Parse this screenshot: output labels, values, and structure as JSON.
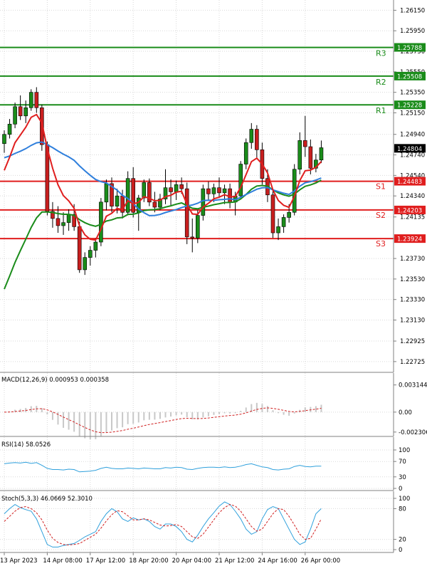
{
  "colors": {
    "background": "#ffffff",
    "grid": "#d9d9d9",
    "frame": "#b0b0b0",
    "bull_candle": "#1a8c1a",
    "bear_candle": "#c81e1e",
    "resistance": "#1a8c1a",
    "support": "#e01e1e",
    "ma_red": "#e01e1e",
    "ma_blue": "#2f7fdc",
    "ma_green": "#1a8c1a",
    "macd_hist": "#c8c8c8",
    "macd_signal": "#d02020",
    "rsi_line": "#2fa0dc",
    "stoch_k": "#2fa0dc",
    "stoch_d": "#d02020",
    "price_tag": "#000000"
  },
  "chart_data": [
    {
      "type": "candlestick",
      "title": "",
      "ylim": [
        1.2262,
        1.2625
      ],
      "y_ticks": [
        "1.26150",
        "1.25950",
        "1.25750",
        "1.25550",
        "1.25350",
        "1.25150",
        "1.24940",
        "1.24740",
        "1.24540",
        "1.24340",
        "1.24135",
        "1.23924",
        "1.23730",
        "1.23530",
        "1.23330",
        "1.23130",
        "1.22925",
        "1.22725"
      ],
      "x_tick_labels": [
        "13 Apr 2023",
        "14 Apr 08:00",
        "17 Apr 12:00",
        "18 Apr 20:00",
        "20 Apr 04:00",
        "21 Apr 12:00",
        "24 Apr 16:00",
        "26 Apr 00:00"
      ],
      "levels": [
        {
          "label": "R3",
          "value": 1.25788,
          "tag": "1.25788",
          "kind": "resistance"
        },
        {
          "label": "R2",
          "value": 1.25508,
          "tag": "1.25508",
          "kind": "resistance"
        },
        {
          "label": "R1",
          "value": 1.25228,
          "tag": "1.25228",
          "kind": "resistance"
        },
        {
          "label": "S1",
          "value": 1.24483,
          "tag": "1.24483",
          "kind": "support"
        },
        {
          "label": "S2",
          "value": 1.24203,
          "tag": "1.24203",
          "kind": "support"
        },
        {
          "label": "S3",
          "value": 1.23924,
          "tag": "1.23924",
          "kind": "support"
        }
      ],
      "current_price": {
        "value": 1.24804,
        "tag": "1.24804"
      },
      "candles": [
        [
          1.2485,
          1.2498,
          1.2476,
          1.2494
        ],
        [
          1.2494,
          1.2509,
          1.249,
          1.2504
        ],
        [
          1.2504,
          1.2525,
          1.25,
          1.2521
        ],
        [
          1.2521,
          1.2532,
          1.2508,
          1.2512
        ],
        [
          1.2512,
          1.2527,
          1.2505,
          1.252
        ],
        [
          1.252,
          1.2538,
          1.2517,
          1.2535
        ],
        [
          1.2535,
          1.254,
          1.2515,
          1.252
        ],
        [
          1.252,
          1.2523,
          1.2478,
          1.2484
        ],
        [
          1.2484,
          1.2487,
          1.2415,
          1.2419
        ],
        [
          1.2419,
          1.2428,
          1.2403,
          1.2412
        ],
        [
          1.2412,
          1.2424,
          1.2398,
          1.2405
        ],
        [
          1.2405,
          1.2418,
          1.2396,
          1.2408
        ],
        [
          1.2408,
          1.2421,
          1.24,
          1.2416
        ],
        [
          1.2416,
          1.2426,
          1.24,
          1.2404
        ],
        [
          1.2404,
          1.2409,
          1.2359,
          1.2362
        ],
        [
          1.2362,
          1.2379,
          1.2357,
          1.2374
        ],
        [
          1.2374,
          1.2385,
          1.2366,
          1.2381
        ],
        [
          1.2381,
          1.2393,
          1.2374,
          1.2389
        ],
        [
          1.2389,
          1.2432,
          1.2385,
          1.2428
        ],
        [
          1.2428,
          1.245,
          1.242,
          1.2446
        ],
        [
          1.2446,
          1.2452,
          1.2418,
          1.2424
        ],
        [
          1.2424,
          1.2441,
          1.2417,
          1.2434
        ],
        [
          1.2434,
          1.244,
          1.2412,
          1.2418
        ],
        [
          1.2418,
          1.2458,
          1.2415,
          1.2451
        ],
        [
          1.2451,
          1.2462,
          1.2413,
          1.2418
        ],
        [
          1.2418,
          1.2435,
          1.24,
          1.2432
        ],
        [
          1.2432,
          1.245,
          1.2428,
          1.2447
        ],
        [
          1.2447,
          1.2451,
          1.2424,
          1.2428
        ],
        [
          1.2428,
          1.2438,
          1.2418,
          1.2423
        ],
        [
          1.2423,
          1.2436,
          1.242,
          1.2431
        ],
        [
          1.2431,
          1.246,
          1.2426,
          1.2442
        ],
        [
          1.2442,
          1.245,
          1.2425,
          1.2438
        ],
        [
          1.2438,
          1.2449,
          1.243,
          1.2445
        ],
        [
          1.2445,
          1.2452,
          1.2436,
          1.2441
        ],
        [
          1.2441,
          1.2447,
          1.2387,
          1.2394
        ],
        [
          1.2394,
          1.2412,
          1.2379,
          1.2393
        ],
        [
          1.2393,
          1.242,
          1.2388,
          1.2415
        ],
        [
          1.2415,
          1.2445,
          1.241,
          1.2441
        ],
        [
          1.2441,
          1.2448,
          1.243,
          1.2436
        ],
        [
          1.2436,
          1.2446,
          1.2428,
          1.2442
        ],
        [
          1.2442,
          1.2452,
          1.2432,
          1.2437
        ],
        [
          1.2437,
          1.2445,
          1.2426,
          1.2441
        ],
        [
          1.2441,
          1.2446,
          1.2422,
          1.2428
        ],
        [
          1.2428,
          1.2438,
          1.2415,
          1.2434
        ],
        [
          1.2434,
          1.2468,
          1.2432,
          1.2465
        ],
        [
          1.2465,
          1.249,
          1.246,
          1.2486
        ],
        [
          1.2486,
          1.2505,
          1.248,
          1.2499
        ],
        [
          1.2499,
          1.2503,
          1.247,
          1.2479
        ],
        [
          1.2479,
          1.2486,
          1.2445,
          1.2451
        ],
        [
          1.2451,
          1.246,
          1.2428,
          1.2435
        ],
        [
          1.2435,
          1.2441,
          1.2393,
          1.2398
        ],
        [
          1.2398,
          1.2412,
          1.2391,
          1.2404
        ],
        [
          1.2404,
          1.2416,
          1.2398,
          1.2413
        ],
        [
          1.2413,
          1.2426,
          1.2408,
          1.2418
        ],
        [
          1.2418,
          1.2465,
          1.2415,
          1.246
        ],
        [
          1.246,
          1.2496,
          1.2455,
          1.2488
        ],
        [
          1.2488,
          1.2512,
          1.2472,
          1.2482
        ],
        [
          1.2482,
          1.2489,
          1.2455,
          1.2461
        ],
        [
          1.2461,
          1.2475,
          1.2457,
          1.2469
        ],
        [
          1.2469,
          1.2488,
          1.2466,
          1.2481
        ]
      ]
    },
    {
      "type": "macd",
      "label": "MACD(12,26,9) 0.000953 0.000358",
      "y_ticks": [
        "0.003144",
        "0.00",
        "-0.002306"
      ],
      "ylim": [
        -0.0024,
        0.0032
      ]
    },
    {
      "type": "rsi",
      "label": "RSI(14) 58.0526",
      "y_ticks": [
        "100",
        "70",
        "30",
        "0"
      ],
      "ylim": [
        0,
        100
      ],
      "values": [
        64,
        66,
        67,
        66,
        68,
        65,
        67,
        60,
        52,
        49,
        49,
        48,
        50,
        49,
        43,
        44,
        45,
        47,
        52,
        55,
        52,
        51,
        51,
        53,
        52,
        51,
        53,
        52,
        51,
        51,
        54,
        53,
        55,
        54,
        50,
        49,
        52,
        54,
        55,
        55,
        54,
        56,
        54,
        55,
        58,
        62,
        64,
        60,
        56,
        54,
        49,
        48,
        50,
        51,
        57,
        60,
        57,
        56,
        58,
        58
      ]
    },
    {
      "type": "stochastic",
      "label": "Stoch(5,3,3) 46.0669 52.3010",
      "y_ticks": [
        "100",
        "80",
        "20",
        "0"
      ],
      "ylim": [
        0,
        100
      ],
      "k": [
        70,
        80,
        88,
        82,
        78,
        75,
        60,
        35,
        10,
        5,
        5,
        8,
        10,
        12,
        18,
        25,
        30,
        35,
        55,
        70,
        80,
        74,
        60,
        55,
        62,
        58,
        60,
        55,
        45,
        40,
        50,
        50,
        45,
        35,
        20,
        15,
        28,
        45,
        60,
        72,
        85,
        93,
        88,
        75,
        60,
        40,
        30,
        35,
        60,
        78,
        84,
        80,
        60,
        40,
        20,
        10,
        15,
        40,
        70,
        80
      ],
      "d": [
        55,
        65,
        75,
        82,
        84,
        80,
        72,
        58,
        38,
        22,
        14,
        10,
        9,
        10,
        12,
        18,
        24,
        30,
        42,
        56,
        68,
        76,
        74,
        66,
        58,
        58,
        60,
        58,
        53,
        48,
        46,
        47,
        49,
        45,
        35,
        25,
        22,
        30,
        44,
        58,
        72,
        82,
        88,
        85,
        75,
        60,
        45,
        36,
        40,
        55,
        70,
        80,
        78,
        65,
        48,
        30,
        20,
        22,
        40,
        60
      ]
    }
  ]
}
